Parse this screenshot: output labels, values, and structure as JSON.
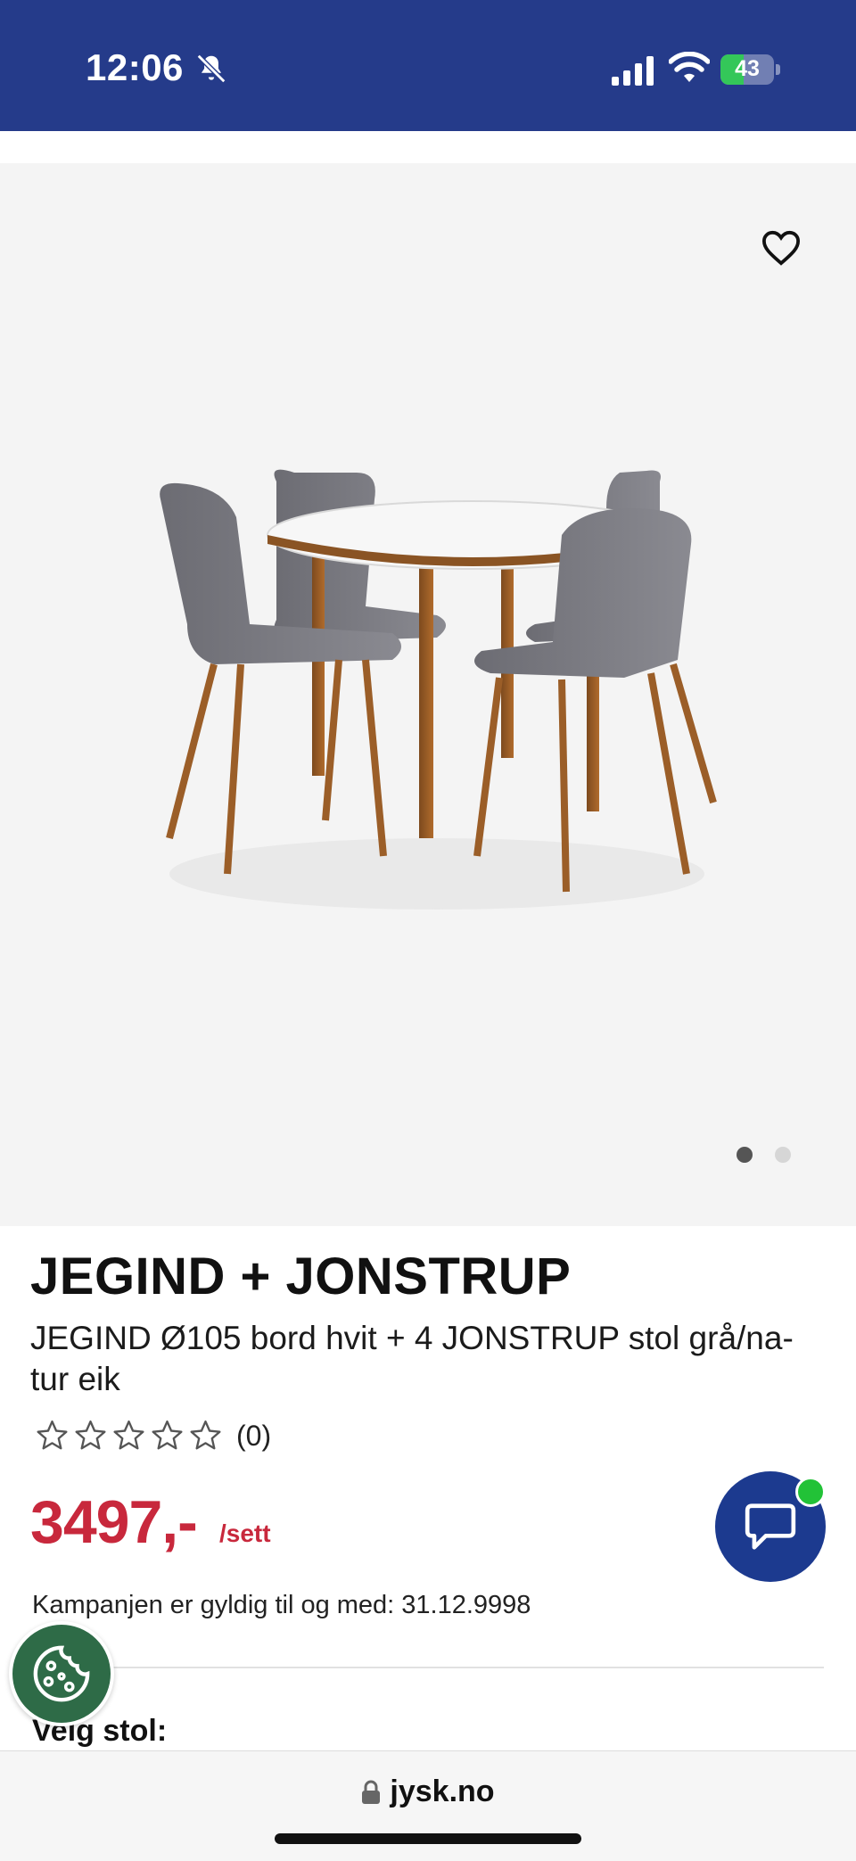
{
  "status_bar": {
    "time": "12:06",
    "battery": "43",
    "battery_level": 0.43,
    "bell_icon": "bell-slash-icon",
    "signal_icon": "signal-icon",
    "wifi_icon": "wifi-icon"
  },
  "product": {
    "title": "JEGIND + JONSTRUP",
    "description": "JEGIND Ø105 bord hvit + 4 JONSTRUP stol grå/na-tur eik",
    "rating_stars": 0,
    "rating_count": "(0)",
    "price": "3497,-",
    "price_unit": "/sett",
    "campaign": "Kampanjen er gyldig til og med: 31.12.9998",
    "section_label": "Velg stol:"
  },
  "gallery": {
    "images": 2,
    "active_index": 0,
    "favorite_icon": "heart-outline-icon"
  },
  "colors": {
    "header_blue": "#253b8a",
    "price_red": "#c8283c",
    "chat_blue": "#1c3a8f",
    "cookie_green": "#2e6b47",
    "online_green": "#22c237"
  },
  "browser": {
    "url": "jysk.no",
    "lock_icon": "lock-icon"
  }
}
